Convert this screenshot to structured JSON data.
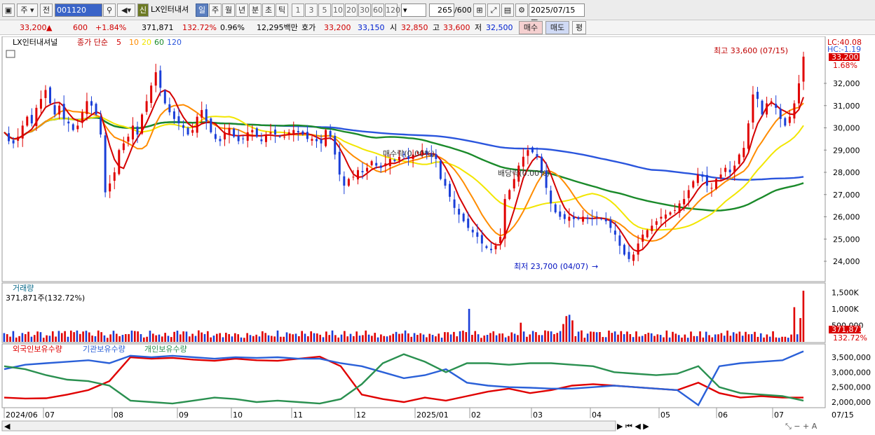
{
  "toolbar": {
    "market": "주",
    "prev": "전",
    "code": "001120",
    "name": "LX인터내셔",
    "badge": "신",
    "periods": [
      "일",
      "주",
      "월",
      "년",
      "분",
      "초",
      "틱"
    ],
    "active_period": "일",
    "nums": [
      "1",
      "3",
      "5",
      "10",
      "20",
      "30",
      "60",
      "120"
    ],
    "count": "265",
    "total": "/600",
    "date": "2025/07/15"
  },
  "quote": {
    "price": "33,200",
    "arrow": "▲",
    "change": "600",
    "pct": "+1.84%",
    "volume": "371,871",
    "vol_ratio": "132.72%",
    "turnover": "0.96%",
    "amount": "12,295백만",
    "hoga_label": "호가",
    "ask": "33,200",
    "bid": "33,150",
    "open_label": "시",
    "open": "32,850",
    "high_label": "고",
    "high": "33,600",
    "low_label": "저",
    "low": "32,500",
    "buy": "매수",
    "sell": "매도",
    "avg": "평"
  },
  "price_panel": {
    "legend_name": "LX인터내셔널",
    "legend_ma": "종가 단순",
    "ma_periods": [
      "5",
      "10",
      "20",
      "60",
      "120"
    ],
    "ma_colors": [
      "#d40000",
      "#ff8c00",
      "#f2e600",
      "#1a8a2a",
      "#2a55dd"
    ],
    "lc": "LC:40.08",
    "hc": "HC:-1.19",
    "last_price": "33,200",
    "last_pct": "1.68%",
    "max_label": "최고 33,600 (07/15)",
    "min_label": "최저 23,700 (04/07)",
    "ann1": "매수락(0.00%)",
    "ann2": "배당락(0.00%)"
  },
  "volume_panel": {
    "title": "거래량",
    "info": "371,871주(132.72%)",
    "last": "371,871",
    "last_pct": "132.72%"
  },
  "holdings_panel": {
    "titles": [
      "외국인보유수량",
      "기관보유수량",
      "개인보유수량"
    ],
    "colors": [
      "#e00000",
      "#2a60d8",
      "#2a9050"
    ]
  },
  "x_labels": [
    "2024/06",
    "07",
    "08",
    "09",
    "10",
    "11",
    "12",
    "2025/01",
    "02",
    "03",
    "04",
    "05",
    "06",
    "07"
  ],
  "date_right": "07/15",
  "chart_data": [
    {
      "type": "candlestick",
      "title": "LX인터내셔널",
      "y_ticks": [
        24000,
        25000,
        26000,
        27000,
        28000,
        29000,
        30000,
        31000,
        32000
      ],
      "closes": [
        29800,
        29400,
        29300,
        29600,
        30100,
        30500,
        30200,
        30900,
        31300,
        31700,
        31100,
        30600,
        31000,
        30400,
        30200,
        29900,
        30100,
        30700,
        31200,
        31000,
        30600,
        29700,
        27100,
        27500,
        28000,
        29000,
        29300,
        29600,
        30100,
        29700,
        30600,
        31200,
        31900,
        32500,
        31800,
        31100,
        30700,
        30400,
        30200,
        30000,
        29700,
        29900,
        30500,
        30800,
        30300,
        29800,
        29500,
        29400,
        29800,
        30000,
        29600,
        29400,
        29500,
        29800,
        29900,
        29600,
        29400,
        29700,
        29800,
        29700,
        29600,
        29600,
        29800,
        29900,
        29800,
        29700,
        29500,
        29500,
        29400,
        29300,
        29900,
        29600,
        28800,
        27900,
        27400,
        27700,
        27800,
        28100,
        28000,
        28200,
        28500,
        28300,
        28200,
        28400,
        28600,
        28500,
        28700,
        28800,
        28600,
        28800,
        28900,
        29000,
        28800,
        28700,
        28600,
        27700,
        27400,
        26900,
        26400,
        26100,
        25800,
        25500,
        25300,
        25100,
        24800,
        24600,
        24500,
        24700,
        25100,
        26800,
        27200,
        27700,
        28300,
        28700,
        29000,
        28900,
        28700,
        28000,
        27300,
        26600,
        26200,
        26000,
        25900,
        26000,
        25900,
        25900,
        26000,
        25900,
        25900,
        26000,
        25900,
        25800,
        25500,
        25200,
        24700,
        24300,
        24100,
        24300,
        24800,
        25200,
        25400,
        25600,
        25800,
        26000,
        26100,
        26200,
        26300,
        26600,
        26800,
        27200,
        27600,
        27900,
        27800,
        27400,
        27300,
        27700,
        27900,
        28200,
        28000,
        28300,
        28800,
        29100,
        30200,
        31500,
        31300,
        30600,
        31100,
        31200,
        30900,
        30400,
        30100,
        30500,
        31100,
        32000,
        33200
      ],
      "ma": {
        "5": [],
        "10": [],
        "20": [],
        "60": [],
        "120": []
      },
      "high": 33600,
      "low": 23700,
      "high_date": "07/15",
      "low_date": "04/07"
    },
    {
      "type": "bar",
      "title": "거래량",
      "y_ticks_label": [
        "500,000",
        "1,000K",
        "1,500K"
      ],
      "y_ticks": [
        500000,
        1000000,
        1500000
      ],
      "values": [
        265,
        233,
        157,
        326,
        129,
        173,
        268,
        233,
        306,
        156,
        207,
        314,
        294,
        124,
        198,
        184,
        319,
        159,
        331,
        266,
        325,
        154,
        341,
        294,
        343,
        238,
        314,
        336,
        286,
        190,
        170,
        344,
        294,
        195,
        121,
        226,
        336,
        244,
        170,
        211,
        234,
        235,
        341,
        327,
        317,
        234,
        132,
        154,
        338,
        248,
        198,
        220,
        162,
        273,
        182,
        146,
        302,
        339,
        225,
        317,
        311,
        164,
        244,
        180,
        347,
        284,
        236,
        322,
        135,
        189,
        242,
        265,
        140,
        276,
        234,
        164,
        261,
        231,
        132,
        122,
        265,
        207,
        174,
        216,
        164,
        320,
        269,
        198,
        180,
        163,
        343,
        154,
        154,
        288,
        251,
        229,
        246,
        171,
        329,
        246,
        169,
        319,
        262,
        254,
        215,
        141,
        312,
        207,
        344,
        204,
        130,
        220,
        328,
        166,
        242,
        171,
        314,
        190,
        203,
        342,
        219,
        182,
        273,
        134,
        224,
        176,
        165,
        196,
        242,
        301,
        242,
        250,
        344,
        256,
        152,
        265,
        211,
        260,
        221,
        139,
        243,
        211,
        167,
        248,
        127,
        295,
        292,
        224,
        300,
        168,
        321,
        339,
        296,
        282,
        213,
        327,
        230,
        120,
        191,
        212,
        268,
        318,
        199,
        252,
        254,
        135,
        177,
        287,
        246,
        205,
        328,
        313,
        153,
        225,
        330,
        295,
        207,
        204,
        346,
        327,
        317,
        233,
        271,
        326,
        305,
        339,
        142,
        224,
        171,
        310,
        346,
        125,
        250,
        312,
        304,
        292,
        297,
        147,
        142,
        341,
        272,
        316,
        218,
        325,
        232,
        312,
        234,
        145,
        317,
        160,
        181,
        235,
        276,
        258,
        179,
        227,
        211,
        137,
        342,
        132,
        303,
        248,
        207,
        129,
        221,
        125,
        312,
        175,
        173,
        317,
        131,
        307,
        204,
        137,
        224,
        229,
        264,
        187,
        341,
        185,
        291,
        248,
        309,
        186,
        303,
        230,
        233,
        303,
        150,
        259,
        131,
        224,
        157,
        319,
        134,
        123,
        154,
        154,
        126,
        221,
        329,
        229,
        267,
        372
      ],
      "spikes": {
        "153": 1000,
        "170": 580,
        "184": 540,
        "185": 780,
        "186": 820,
        "187": 650,
        "260": 1050,
        "263": 1550,
        "262": 720
      },
      "last": 371871
    },
    {
      "type": "line",
      "title": "보유수량",
      "y_ticks": [
        2000000,
        2500000,
        3000000,
        3500000
      ],
      "series": [
        {
          "name": "외국인보유수량",
          "values": [
            2150000,
            2120000,
            2130000,
            2250000,
            2400000,
            2700000,
            3500000,
            3450000,
            3480000,
            3420000,
            3380000,
            3450000,
            3400000,
            3380000,
            3450000,
            3520000,
            3200000,
            2250000,
            2100000,
            2000000,
            2150000,
            2050000,
            2200000,
            2350000,
            2450000,
            2300000,
            2400000,
            2550000,
            2600000,
            2550000,
            2500000,
            2450000,
            2400000,
            2650000,
            2300000,
            2150000,
            2200000,
            2150000,
            2150000
          ]
        },
        {
          "name": "기관보유수량",
          "values": [
            3100000,
            3250000,
            3300000,
            3350000,
            3400000,
            3300000,
            3550000,
            3500000,
            3550000,
            3500000,
            3450000,
            3500000,
            3480000,
            3500000,
            3450000,
            3450000,
            3300000,
            3200000,
            3000000,
            2800000,
            2900000,
            3100000,
            2650000,
            2550000,
            2500000,
            2480000,
            2450000,
            2450000,
            2500000,
            2550000,
            2500000,
            2450000,
            2400000,
            1900000,
            3200000,
            3300000,
            3350000,
            3400000,
            3700000
          ]
        },
        {
          "name": "개인보유수량",
          "values": [
            3200000,
            3100000,
            2900000,
            2750000,
            2700000,
            2550000,
            2050000,
            2000000,
            1950000,
            2050000,
            2150000,
            2100000,
            2000000,
            2050000,
            2000000,
            1950000,
            2100000,
            2600000,
            3300000,
            3600000,
            3350000,
            3000000,
            3300000,
            3300000,
            3250000,
            3300000,
            3300000,
            3250000,
            3200000,
            3000000,
            2950000,
            2900000,
            2950000,
            3200000,
            2500000,
            2300000,
            2250000,
            2200000,
            2050000
          ]
        }
      ]
    }
  ]
}
